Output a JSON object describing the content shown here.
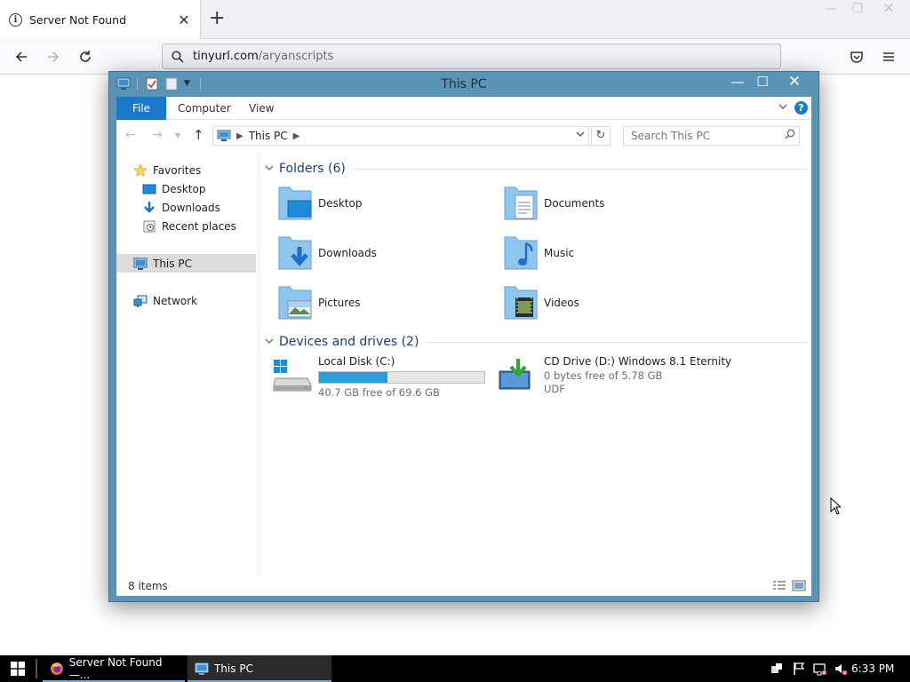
{
  "browser": {
    "tab_title": "Server Not Found",
    "url_host": "tinyurl.com",
    "url_path": "/aryanscripts"
  },
  "explorer": {
    "title": "This PC",
    "ribbon": {
      "file": "File",
      "computer": "Computer",
      "view": "View"
    },
    "address": {
      "location": "This PC"
    },
    "search": {
      "placeholder": "Search This PC"
    },
    "nav": {
      "favorites": "Favorites",
      "desktop": "Desktop",
      "downloads": "Downloads",
      "recent_places": "Recent places",
      "this_pc": "This PC",
      "network": "Network"
    },
    "folders_header": "Folders (6)",
    "folders": [
      {
        "label": "Desktop"
      },
      {
        "label": "Documents"
      },
      {
        "label": "Downloads"
      },
      {
        "label": "Music"
      },
      {
        "label": "Pictures"
      },
      {
        "label": "Videos"
      }
    ],
    "drives_header": "Devices and drives (2)",
    "drives": [
      {
        "name": "Local Disk (C:)",
        "free_text": "40.7 GB free of 69.6 GB",
        "used_fraction": 0.415
      },
      {
        "name": "CD Drive (D:) Windows 8.1 Eternity",
        "free_text": "0 bytes free of 5.78 GB",
        "fs": "UDF"
      }
    ],
    "status": "8 items"
  },
  "taskbar": {
    "items": [
      {
        "label": "Server Not Found —..."
      },
      {
        "label": "This PC"
      }
    ],
    "clock": "6:33 PM"
  },
  "colors": {
    "accent": "#1979ca",
    "window_frame": "#5b93b5",
    "drive_bar": "#26a0da",
    "group_header": "#1e3c78"
  }
}
